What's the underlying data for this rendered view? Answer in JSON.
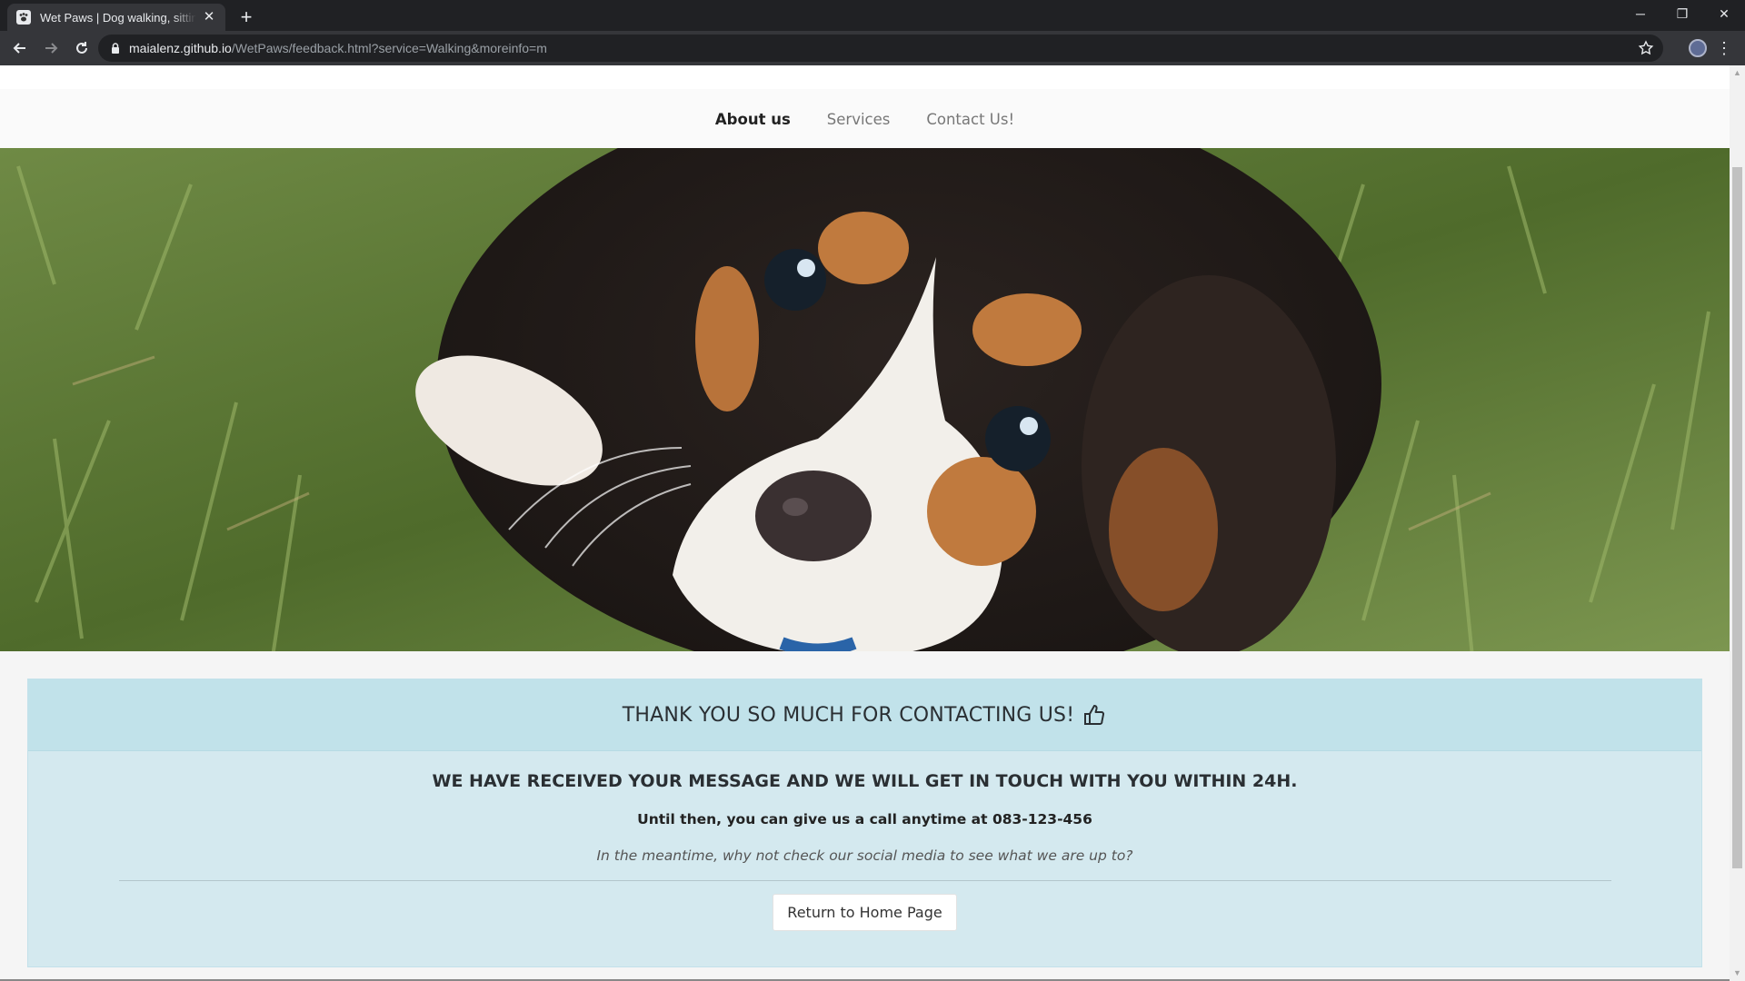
{
  "browser": {
    "tab_title": "Wet Paws | Dog walking, sitting and more",
    "tab_close": "✕",
    "new_tab": "+",
    "url_host": "maialenz.github.io",
    "url_path": "/WetPaws/feedback.html?service=Walking&moreinfo=m",
    "window_controls": {
      "minimize": "─",
      "restore": "❐",
      "close": "✕"
    },
    "menu": "⋮"
  },
  "nav": {
    "items": [
      {
        "label": "About us",
        "active": true
      },
      {
        "label": "Services",
        "active": false
      },
      {
        "label": "Contact Us!",
        "active": false
      }
    ]
  },
  "hero": {
    "image": "puppy-looking-up-in-grass"
  },
  "feedback": {
    "heading": "THANK YOU SO MUCH FOR CONTACTING US!",
    "message": "WE HAVE RECEIVED YOUR MESSAGE AND WE WILL GET IN TOUCH WITH YOU WITHIN 24H.",
    "call_text": "Until then, you can give us a call anytime at 083-123-456",
    "social_text": "In the meantime, why not check our social media to see what we are up to?",
    "button_label": "Return to Home Page"
  },
  "colors": {
    "alert_bg": "#d4e9ef",
    "alert_heading_bg": "#c1e2ea"
  }
}
